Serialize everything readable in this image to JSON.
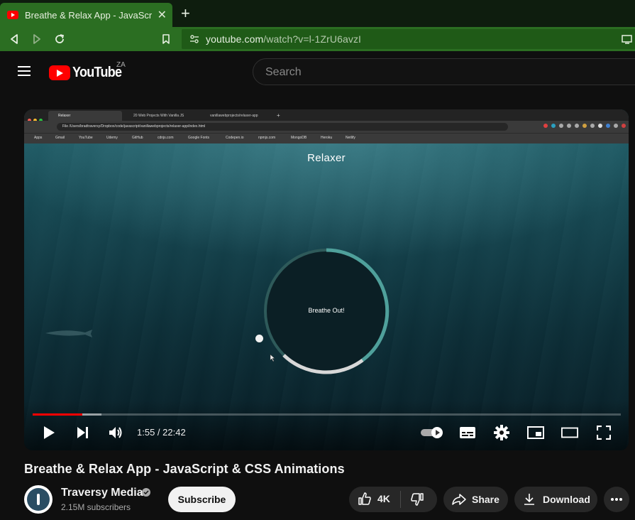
{
  "browser": {
    "tab_title": "Breathe & Relax App - JavaScript & CSS Animations - YouTube",
    "tab_close": "✕",
    "new_tab": "+",
    "url_host": "youtube.com",
    "url_path": "/watch?v=l-1ZrU6avzI"
  },
  "masthead": {
    "logo_text": "YouTube",
    "region": "ZA",
    "search_placeholder": "Search"
  },
  "video_frame": {
    "mini_tabs": [
      "Relaxer",
      "20 Web Projects With Vanilla JS",
      "vanillawebprojects/relaxer-app"
    ],
    "mini_url": "File  /Users/bradtraversy/Dropbox/code/javascript/vanillawebprojects/relaxer-app/index.html",
    "bookmarks": [
      "Apps",
      "Gmail",
      "YouTube",
      "Udemy",
      "GitHub",
      "cdnjs.com",
      "Google Fonts",
      "Codepen.io",
      "npmjs.com",
      "MongoDB",
      "Heroku",
      "Netlify"
    ],
    "app_title": "Relaxer",
    "ring_text": "Breathe Out!"
  },
  "player": {
    "current_time": "1:55",
    "duration": "22:42",
    "time_display": "1:55 / 22:42",
    "played_fraction": 0.0844,
    "buffered_fraction": 0.1175
  },
  "video": {
    "title": "Breathe & Relax App - JavaScript & CSS Animations"
  },
  "channel": {
    "name": "Traversy Media",
    "subscribers": "2.15M subscribers",
    "subscribe_label": "Subscribe"
  },
  "actions": {
    "like_count": "4K",
    "share_label": "Share",
    "download_label": "Download"
  },
  "colors": {
    "browser_accent": "#2b6e22",
    "youtube_red": "#ff0000",
    "ring_teal": "#4fa09b"
  }
}
